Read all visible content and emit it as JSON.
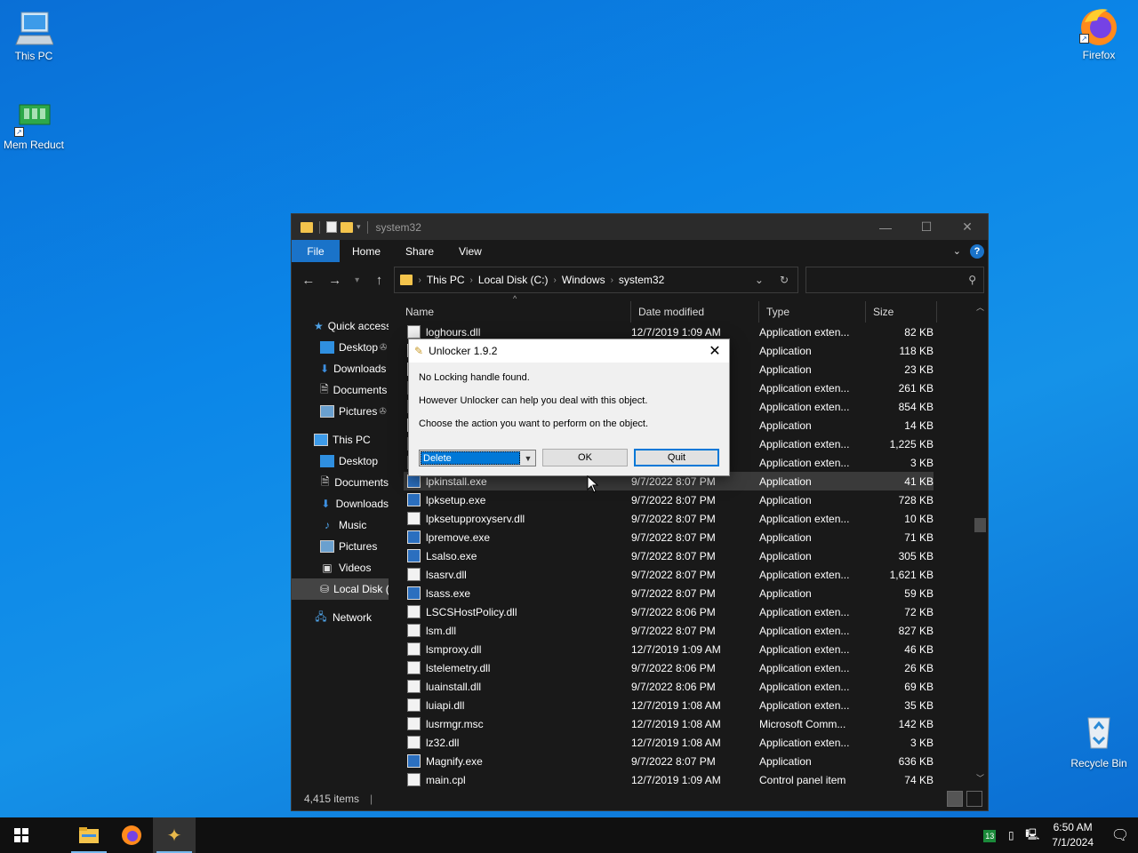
{
  "desktop": {
    "icons": [
      {
        "label": "This PC",
        "icon": "this-pc-icon"
      },
      {
        "label": "Mem Reduct",
        "icon": "mem-reduct-icon"
      },
      {
        "label": "Firefox",
        "icon": "firefox-icon"
      },
      {
        "label": "Recycle Bin",
        "icon": "recycle-bin-icon"
      }
    ]
  },
  "explorer": {
    "title": "system32",
    "ribbon": {
      "file": "File",
      "home": "Home",
      "share": "Share",
      "view": "View"
    },
    "breadcrumb": [
      "This PC",
      "Local Disk (C:)",
      "Windows",
      "system32"
    ],
    "search_placeholder": "",
    "nav": {
      "quick_access": "Quick access",
      "qa_items": [
        "Desktop",
        "Downloads",
        "Documents",
        "Pictures"
      ],
      "this_pc": "This PC",
      "pc_items": [
        "Desktop",
        "Documents",
        "Downloads",
        "Music",
        "Pictures",
        "Videos",
        "Local Disk (C:)"
      ],
      "network": "Network"
    },
    "columns": {
      "name": "Name",
      "date": "Date modified",
      "type": "Type",
      "size": "Size"
    },
    "files": [
      {
        "name": "loghours.dll",
        "date": "12/7/2019 1:09 AM",
        "type": "Application exten...",
        "size": "82 KB",
        "kind": "dll"
      },
      {
        "name": "",
        "date": "",
        "type": "Application",
        "size": "118 KB",
        "kind": "exe"
      },
      {
        "name": "",
        "date": "",
        "type": "Application",
        "size": "23 KB",
        "kind": "exe"
      },
      {
        "name": "",
        "date": "",
        "type": "Application exten...",
        "size": "261 KB",
        "kind": "dll"
      },
      {
        "name": "",
        "date": "",
        "type": "Application exten...",
        "size": "854 KB",
        "kind": "dll"
      },
      {
        "name": "",
        "date": "",
        "type": "Application",
        "size": "14 KB",
        "kind": "exe"
      },
      {
        "name": "",
        "date": "",
        "type": "Application exten...",
        "size": "1,225 KB",
        "kind": "dll"
      },
      {
        "name": "",
        "date": "",
        "type": "Application exten...",
        "size": "3 KB",
        "kind": "dll"
      },
      {
        "name": "lpkinstall.exe",
        "date": "9/7/2022 8:07 PM",
        "type": "Application",
        "size": "41 KB",
        "kind": "exe"
      },
      {
        "name": "lpksetup.exe",
        "date": "9/7/2022 8:07 PM",
        "type": "Application",
        "size": "728 KB",
        "kind": "exe"
      },
      {
        "name": "lpksetupproxyserv.dll",
        "date": "9/7/2022 8:07 PM",
        "type": "Application exten...",
        "size": "10 KB",
        "kind": "dll"
      },
      {
        "name": "lpremove.exe",
        "date": "9/7/2022 8:07 PM",
        "type": "Application",
        "size": "71 KB",
        "kind": "exe"
      },
      {
        "name": "Lsalso.exe",
        "date": "9/7/2022 8:07 PM",
        "type": "Application",
        "size": "305 KB",
        "kind": "exe"
      },
      {
        "name": "lsasrv.dll",
        "date": "9/7/2022 8:07 PM",
        "type": "Application exten...",
        "size": "1,621 KB",
        "kind": "dll"
      },
      {
        "name": "lsass.exe",
        "date": "9/7/2022 8:07 PM",
        "type": "Application",
        "size": "59 KB",
        "kind": "exe"
      },
      {
        "name": "LSCSHostPolicy.dll",
        "date": "9/7/2022 8:06 PM",
        "type": "Application exten...",
        "size": "72 KB",
        "kind": "dll"
      },
      {
        "name": "lsm.dll",
        "date": "9/7/2022 8:07 PM",
        "type": "Application exten...",
        "size": "827 KB",
        "kind": "dll"
      },
      {
        "name": "lsmproxy.dll",
        "date": "12/7/2019 1:09 AM",
        "type": "Application exten...",
        "size": "46 KB",
        "kind": "dll"
      },
      {
        "name": "lstelemetry.dll",
        "date": "9/7/2022 8:06 PM",
        "type": "Application exten...",
        "size": "26 KB",
        "kind": "dll"
      },
      {
        "name": "luainstall.dll",
        "date": "9/7/2022 8:06 PM",
        "type": "Application exten...",
        "size": "69 KB",
        "kind": "dll"
      },
      {
        "name": "luiapi.dll",
        "date": "12/7/2019 1:08 AM",
        "type": "Application exten...",
        "size": "35 KB",
        "kind": "dll"
      },
      {
        "name": "lusrmgr.msc",
        "date": "12/7/2019 1:08 AM",
        "type": "Microsoft Comm...",
        "size": "142 KB",
        "kind": "msc"
      },
      {
        "name": "lz32.dll",
        "date": "12/7/2019 1:08 AM",
        "type": "Application exten...",
        "size": "3 KB",
        "kind": "dll"
      },
      {
        "name": "Magnify.exe",
        "date": "9/7/2022 8:07 PM",
        "type": "Application",
        "size": "636 KB",
        "kind": "exe"
      },
      {
        "name": "main.cpl",
        "date": "12/7/2019 1:09 AM",
        "type": "Control panel item",
        "size": "74 KB",
        "kind": "dll"
      }
    ],
    "status": "4,415 items"
  },
  "dialog": {
    "title": "Unlocker 1.9.2",
    "line1": "No Locking handle found.",
    "line2": "However Unlocker can help you deal with this object.",
    "line3": "Choose the action you want to perform on the object.",
    "action_selected": "Delete",
    "ok": "OK",
    "quit": "Quit"
  },
  "taskbar": {
    "time": "6:50 AM",
    "date": "7/1/2024",
    "tray_badge": "13"
  },
  "colors": {
    "accent": "#0078d7",
    "ribbon_file": "#1a73c9",
    "explorer_bg": "#191919"
  }
}
